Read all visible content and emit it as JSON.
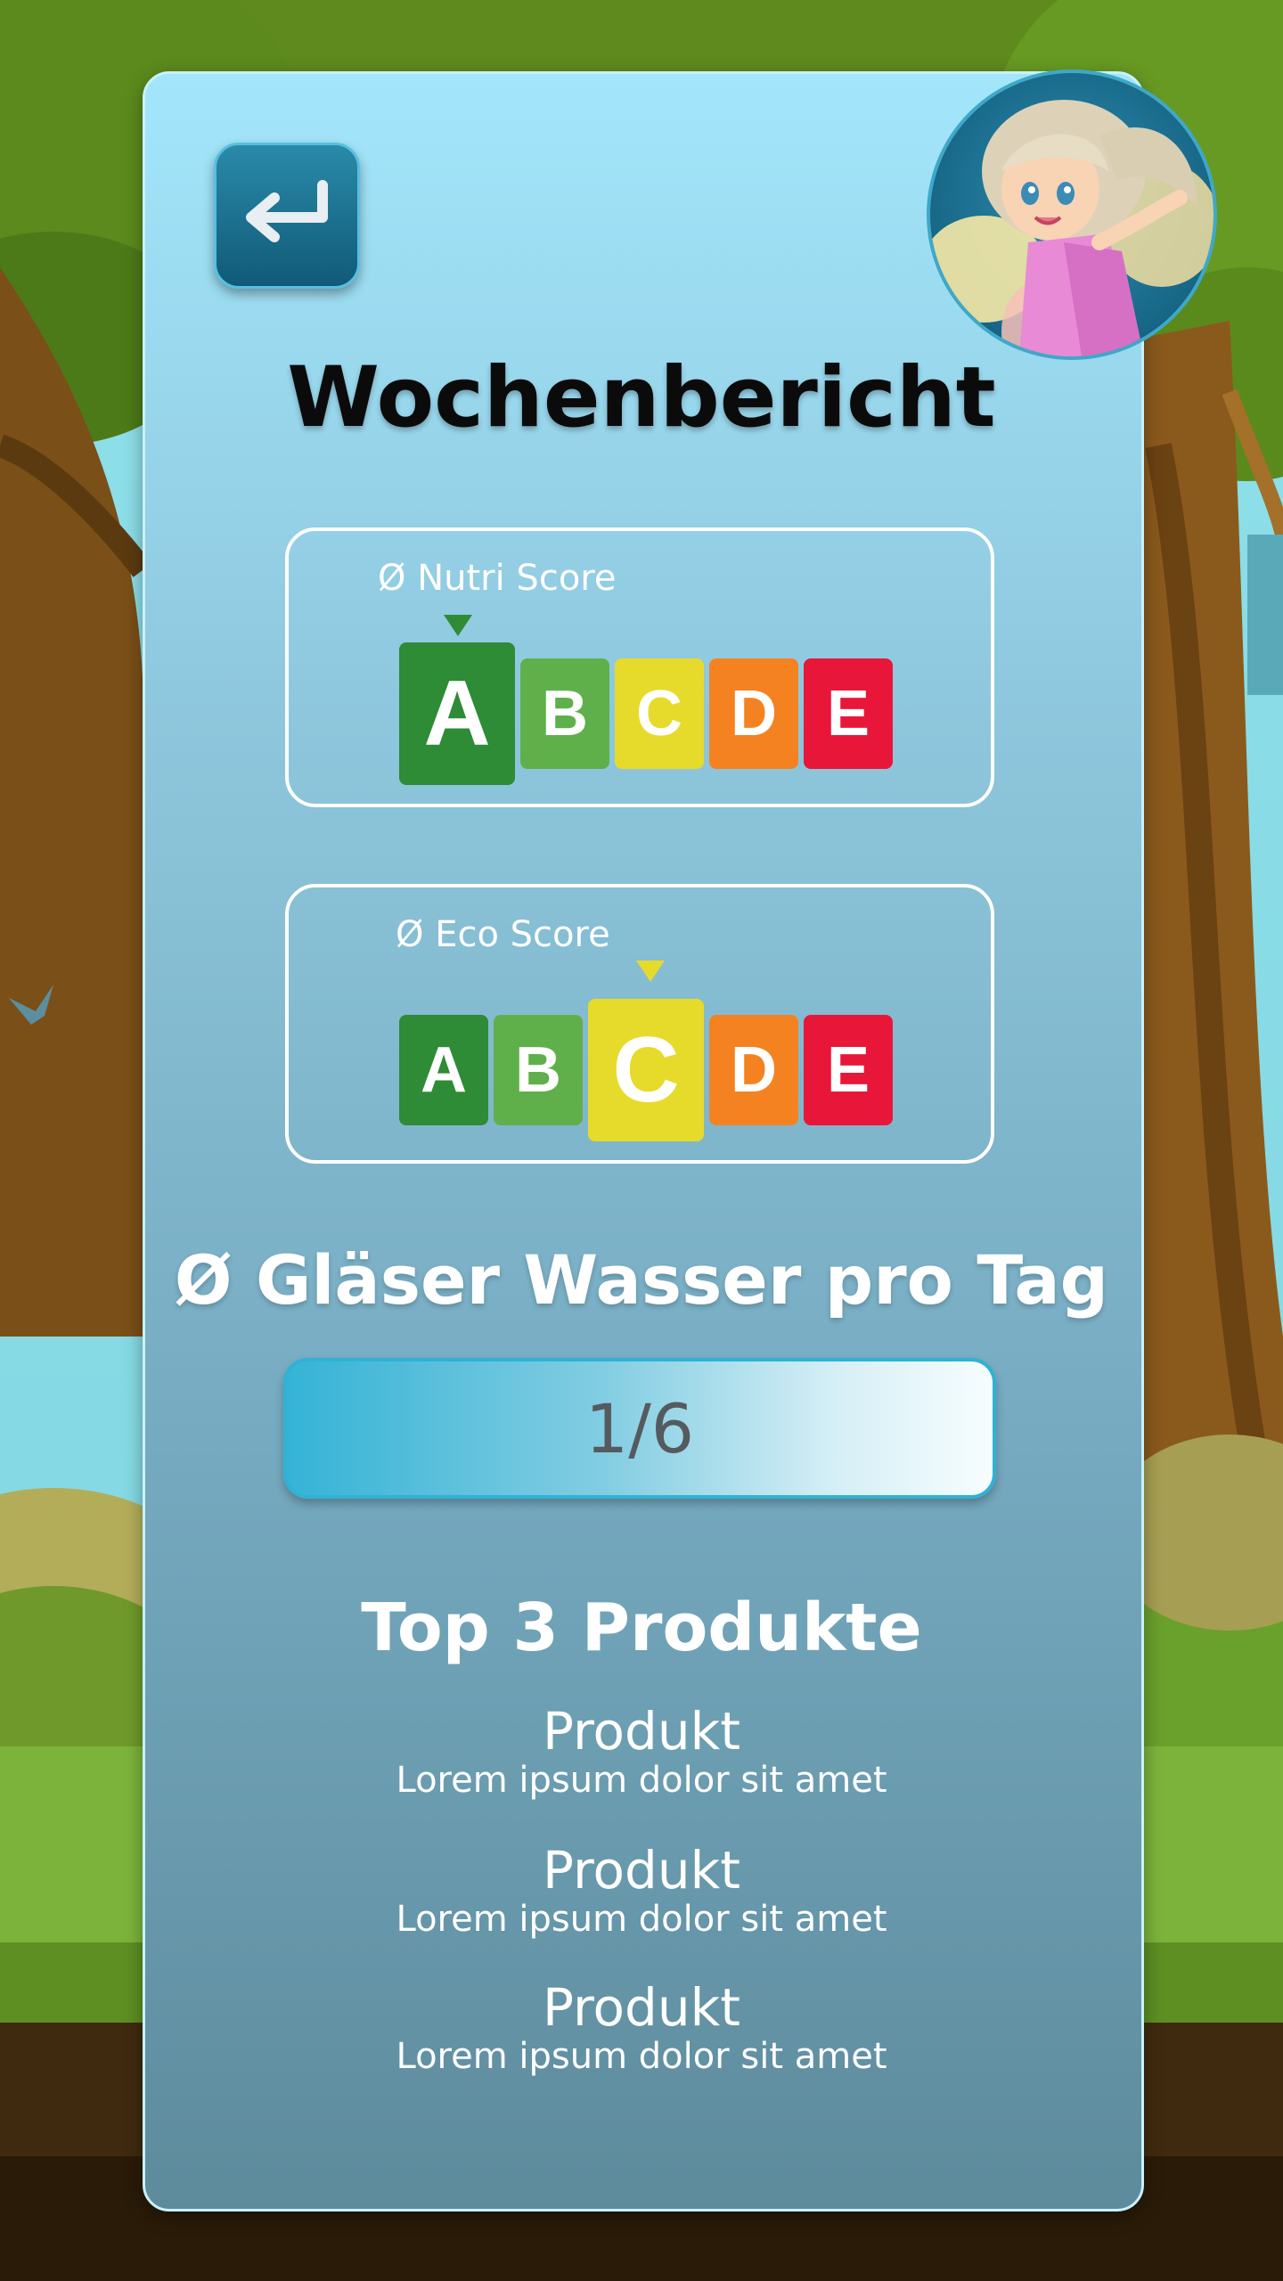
{
  "header": {
    "title": "Wochenbericht",
    "back_icon": "return-arrow-icon",
    "avatar": "fairy-avatar"
  },
  "nutri_score": {
    "label": "Ø Nutri Score",
    "grades": [
      "A",
      "B",
      "C",
      "D",
      "E"
    ],
    "selected": "A"
  },
  "eco_score": {
    "label": "Ø Eco Score",
    "grades": [
      "A",
      "B",
      "C",
      "D",
      "E"
    ],
    "selected": "C"
  },
  "grade_colors": {
    "A": "#2e8b36",
    "B": "#5fb04b",
    "C": "#e6db2b",
    "D": "#f58220",
    "E": "#e8173a"
  },
  "water": {
    "title": "Ø Gläser Wasser pro Tag",
    "value_text": "1/6",
    "current": 1,
    "goal": 6
  },
  "top_products": {
    "title": "Top 3 Produkte",
    "items": [
      {
        "name": "Produkt",
        "description": "Lorem ipsum dolor sit amet"
      },
      {
        "name": "Produkt",
        "description": "Lorem ipsum dolor sit amet"
      },
      {
        "name": "Produkt",
        "description": "Lorem ipsum dolor sit amet"
      }
    ]
  }
}
